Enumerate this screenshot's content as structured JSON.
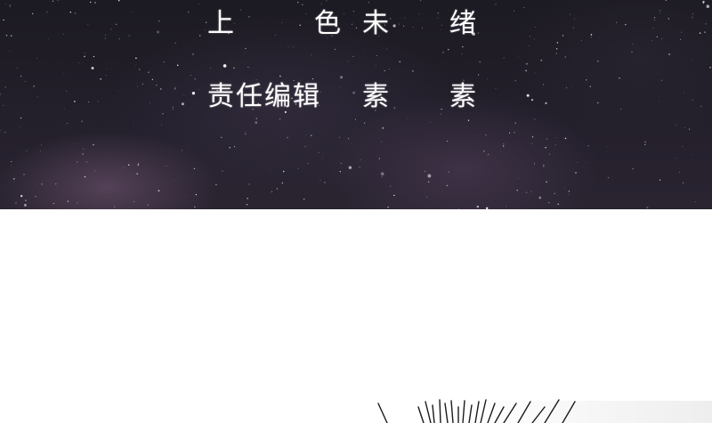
{
  "credits": {
    "row1": {
      "char1": "上",
      "char2": "色",
      "char3": "未",
      "char4": "绪"
    },
    "row2": {
      "role": "责任编辑",
      "name1": "素",
      "name2": "素"
    }
  },
  "colors": {
    "sky": "#1c1a22",
    "text": "#ffffff",
    "page": "#ffffff"
  }
}
